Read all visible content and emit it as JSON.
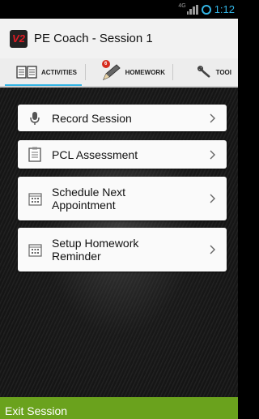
{
  "status_bar": {
    "network_label": "4G",
    "time": "1:12"
  },
  "app": {
    "title": "PE Coach - Session 1",
    "logo_text": "V2"
  },
  "tabs": [
    {
      "label": "ACTIVITIES",
      "icon": "book-icon",
      "selected": true
    },
    {
      "label": "HOMEWORK",
      "icon": "pencil-icon",
      "badge": "6"
    },
    {
      "label": "TOOI",
      "icon": "wrench-icon"
    }
  ],
  "menu": [
    {
      "label": "Record Session",
      "icon": "microphone-icon"
    },
    {
      "label": "PCL Assessment",
      "icon": "clipboard-icon"
    },
    {
      "label": "Schedule Next Appointment",
      "icon": "calendar-icon"
    },
    {
      "label": "Setup Homework Reminder",
      "icon": "calendar-icon"
    }
  ],
  "footer": {
    "exit_label": "Exit Session"
  },
  "colors": {
    "accent": "#33b5e5",
    "footer": "#6aa21d",
    "badge": "#d62c1e"
  }
}
